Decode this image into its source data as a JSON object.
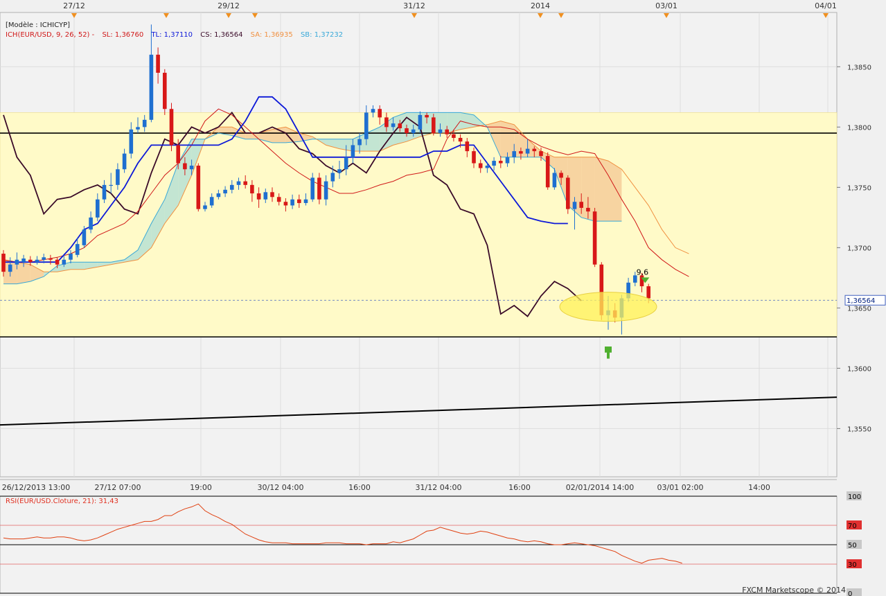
{
  "legend": {
    "model": "[Modèle : ICHICYP]",
    "ich": "ICH(EUR/USD, 9, 26, 52) -",
    "sl": "SL: 1,36760",
    "tl": "TL: 1,37110",
    "cs": "CS: 1,36564",
    "sa": "SA: 1,36935",
    "sb": "SB: 1,37232"
  },
  "rsi_label": "RSI(EUR/USD.Cloture, 21): 31,43",
  "copyright": "FXCM Marketscope © 2014",
  "colors": {
    "background": "#f0f0f0",
    "zone": "#fffac8",
    "bull": "#1f6fd0",
    "bear": "#d81818",
    "tenkan": "#d01818",
    "kijun": "#0c18d8",
    "chikou": "#3a0a28",
    "senkou_a": "#f09040",
    "senkou_b": "#38a8d8",
    "rsi": "#e04010",
    "level_line": "#000000"
  },
  "chart_data": [
    {
      "type": "candlestick",
      "instrument": "EUR/USD",
      "period_labels_top": [
        "27/12",
        "29/12",
        "31/12",
        "2014",
        "03/01",
        "04/01"
      ],
      "time_labels_bottom": [
        "26/12/2013 13:00",
        "27/12 07:00",
        "19:00",
        "30/12 04:00",
        "16:00",
        "31/12 04:00",
        "16:00",
        "02/01/2014 14:00",
        "03/01 02:00",
        "14:00"
      ],
      "y_ticks": [
        "1,3850",
        "1,3800",
        "1,3750",
        "1,3700",
        "1,3650",
        "1,3600",
        "1,3550"
      ],
      "ylim": [
        1.351,
        1.3895
      ],
      "current_price": "1,36564",
      "annotation": "9,6",
      "candles": [
        [
          1.3695,
          1.368,
          1.3698,
          1.3676
        ],
        [
          1.368,
          1.3686,
          1.3692,
          1.3676
        ],
        [
          1.3686,
          1.369,
          1.3696,
          1.3682
        ],
        [
          1.3688,
          1.3691,
          1.3694,
          1.3684
        ],
        [
          1.369,
          1.3688,
          1.3693,
          1.3685
        ],
        [
          1.3688,
          1.369,
          1.3693,
          1.3686
        ],
        [
          1.369,
          1.3692,
          1.3695,
          1.3687
        ],
        [
          1.3691,
          1.369,
          1.3694,
          1.3686
        ],
        [
          1.369,
          1.3686,
          1.3692,
          1.3683
        ],
        [
          1.3686,
          1.369,
          1.3694,
          1.3684
        ],
        [
          1.369,
          1.3695,
          1.3698,
          1.3687
        ],
        [
          1.3694,
          1.3703,
          1.3708,
          1.3692
        ],
        [
          1.3702,
          1.3715,
          1.3718,
          1.37
        ],
        [
          1.3715,
          1.3725,
          1.373,
          1.3712
        ],
        [
          1.3725,
          1.374,
          1.3745,
          1.3722
        ],
        [
          1.374,
          1.3752,
          1.3756,
          1.3737
        ],
        [
          1.3752,
          1.3752,
          1.3762,
          1.3745
        ],
        [
          1.3752,
          1.3765,
          1.377,
          1.3748
        ],
        [
          1.3765,
          1.3778,
          1.3782,
          1.3762
        ],
        [
          1.3778,
          1.3798,
          1.3804,
          1.3774
        ],
        [
          1.3798,
          1.38,
          1.3808,
          1.3795
        ],
        [
          1.38,
          1.3806,
          1.381,
          1.3796
        ],
        [
          1.3806,
          1.386,
          1.3885,
          1.3804
        ],
        [
          1.386,
          1.3845,
          1.3866,
          1.3836
        ],
        [
          1.3845,
          1.3815,
          1.3848,
          1.381
        ],
        [
          1.3815,
          1.3785,
          1.382,
          1.378
        ],
        [
          1.3785,
          1.377,
          1.379,
          1.3765
        ],
        [
          1.377,
          1.3765,
          1.3775,
          1.376
        ],
        [
          1.3765,
          1.3768,
          1.3773,
          1.376
        ],
        [
          1.3768,
          1.3732,
          1.377,
          1.373
        ],
        [
          1.3732,
          1.3735,
          1.3738,
          1.373
        ],
        [
          1.3735,
          1.3742,
          1.3745,
          1.3733
        ],
        [
          1.3742,
          1.3745,
          1.3748,
          1.374
        ],
        [
          1.3745,
          1.3748,
          1.3751,
          1.3742
        ],
        [
          1.3748,
          1.3752,
          1.3756,
          1.3745
        ],
        [
          1.3752,
          1.3755,
          1.3758,
          1.3748
        ],
        [
          1.3755,
          1.3752,
          1.376,
          1.3749
        ],
        [
          1.3752,
          1.3745,
          1.3756,
          1.3738
        ],
        [
          1.3745,
          1.374,
          1.375,
          1.3733
        ],
        [
          1.374,
          1.3746,
          1.3749,
          1.3737
        ],
        [
          1.3746,
          1.3742,
          1.375,
          1.3738
        ],
        [
          1.3742,
          1.3738,
          1.3745,
          1.3735
        ],
        [
          1.3738,
          1.3735,
          1.3741,
          1.373
        ],
        [
          1.3735,
          1.374,
          1.3744,
          1.3732
        ],
        [
          1.374,
          1.3737,
          1.3744,
          1.3733
        ],
        [
          1.3737,
          1.374,
          1.3745,
          1.3735
        ],
        [
          1.374,
          1.3758,
          1.3762,
          1.3738
        ],
        [
          1.3758,
          1.374,
          1.3762,
          1.3736
        ],
        [
          1.374,
          1.3755,
          1.376,
          1.3735
        ],
        [
          1.3755,
          1.3762,
          1.3768,
          1.375
        ],
        [
          1.3762,
          1.3765,
          1.3772,
          1.3757
        ],
        [
          1.3765,
          1.3775,
          1.3785,
          1.376
        ],
        [
          1.3775,
          1.3785,
          1.379,
          1.377
        ],
        [
          1.3785,
          1.379,
          1.3795,
          1.3778
        ],
        [
          1.379,
          1.3812,
          1.3818,
          1.3785
        ],
        [
          1.3812,
          1.3815,
          1.3818,
          1.3808
        ],
        [
          1.3815,
          1.3808,
          1.3818,
          1.3802
        ],
        [
          1.3808,
          1.38,
          1.3812,
          1.3796
        ],
        [
          1.38,
          1.3803,
          1.3808,
          1.3797
        ],
        [
          1.3803,
          1.3799,
          1.3806,
          1.3796
        ],
        [
          1.3799,
          1.3795,
          1.3802,
          1.3792
        ],
        [
          1.3795,
          1.3798,
          1.3802,
          1.3792
        ],
        [
          1.3798,
          1.381,
          1.3813,
          1.3795
        ],
        [
          1.381,
          1.3808,
          1.3812,
          1.3803
        ],
        [
          1.3808,
          1.3795,
          1.3811,
          1.3793
        ],
        [
          1.3795,
          1.3798,
          1.3803,
          1.3792
        ],
        [
          1.3798,
          1.3794,
          1.3801,
          1.3791
        ],
        [
          1.3794,
          1.3791,
          1.3798,
          1.3788
        ],
        [
          1.3791,
          1.3788,
          1.3794,
          1.3783
        ],
        [
          1.3788,
          1.378,
          1.3791,
          1.3775
        ],
        [
          1.378,
          1.377,
          1.3783,
          1.3766
        ],
        [
          1.377,
          1.3766,
          1.3773,
          1.3762
        ],
        [
          1.3766,
          1.3768,
          1.3771,
          1.3762
        ],
        [
          1.3768,
          1.3772,
          1.3775,
          1.3764
        ],
        [
          1.3772,
          1.377,
          1.3776,
          1.3766
        ],
        [
          1.377,
          1.3775,
          1.3779,
          1.3767
        ],
        [
          1.3775,
          1.378,
          1.3786,
          1.377
        ],
        [
          1.378,
          1.3778,
          1.3783,
          1.3773
        ],
        [
          1.3778,
          1.3782,
          1.379,
          1.3775
        ],
        [
          1.3782,
          1.378,
          1.3784,
          1.3775
        ],
        [
          1.378,
          1.3776,
          1.3783,
          1.3772
        ],
        [
          1.3776,
          1.375,
          1.3779,
          1.3748
        ],
        [
          1.375,
          1.3762,
          1.3766,
          1.3748
        ],
        [
          1.3762,
          1.3758,
          1.3764,
          1.3752
        ],
        [
          1.3758,
          1.3732,
          1.376,
          1.3728
        ],
        [
          1.3732,
          1.3738,
          1.3742,
          1.3715
        ],
        [
          1.3738,
          1.3733,
          1.3745,
          1.3728
        ],
        [
          1.3733,
          1.373,
          1.3742,
          1.3724
        ],
        [
          1.373,
          1.3686,
          1.3733,
          1.3684
        ],
        [
          1.3686,
          1.3644,
          1.3688,
          1.364
        ],
        [
          1.3644,
          1.3648,
          1.366,
          1.3632
        ],
        [
          1.3648,
          1.3642,
          1.3654,
          1.3638
        ],
        [
          1.3642,
          1.3658,
          1.3661,
          1.3628
        ],
        [
          1.3658,
          1.3671,
          1.3675,
          1.3655
        ],
        [
          1.3671,
          1.3677,
          1.368,
          1.3668
        ],
        [
          1.3677,
          1.3668,
          1.3679,
          1.3663
        ],
        [
          1.3668,
          1.3658,
          1.367,
          1.3654
        ]
      ],
      "tenkan": [
        1.369,
        1.3688,
        1.3688,
        1.369,
        1.3692,
        1.3695,
        1.37,
        1.371,
        1.3715,
        1.372,
        1.373,
        1.3745,
        1.376,
        1.377,
        1.3785,
        1.3805,
        1.3815,
        1.381,
        1.38,
        1.379,
        1.378,
        1.377,
        1.3762,
        1.3755,
        1.375,
        1.3745,
        1.3745,
        1.3748,
        1.3752,
        1.3755,
        1.376,
        1.3762,
        1.3765,
        1.379,
        1.3805,
        1.3802,
        1.38,
        1.38,
        1.3798,
        1.379,
        1.3784,
        1.378,
        1.3777,
        1.378,
        1.3778,
        1.376,
        1.374,
        1.3722,
        1.37,
        1.369,
        1.3682,
        1.3676
      ],
      "kijun": [
        1.3688,
        1.3688,
        1.3688,
        1.3688,
        1.3688,
        1.37,
        1.3715,
        1.372,
        1.3735,
        1.375,
        1.377,
        1.3785,
        1.3785,
        1.3785,
        1.3785,
        1.3785,
        1.3785,
        1.379,
        1.3805,
        1.3825,
        1.3825,
        1.3815,
        1.3795,
        1.3775,
        1.3775,
        1.3775,
        1.3775,
        1.3775,
        1.3775,
        1.3775,
        1.3775,
        1.3775,
        1.378,
        1.378,
        1.3785,
        1.3785,
        1.377,
        1.3755,
        1.374,
        1.3725,
        1.3722,
        1.372,
        1.372
      ],
      "chikou": [
        1.381,
        1.3775,
        1.376,
        1.3728,
        1.374,
        1.3742,
        1.3748,
        1.3752,
        1.3745,
        1.3732,
        1.3728,
        1.3762,
        1.379,
        1.3785,
        1.38,
        1.3795,
        1.38,
        1.3812,
        1.3795,
        1.3795,
        1.38,
        1.3795,
        1.3782,
        1.3778,
        1.3768,
        1.3762,
        1.377,
        1.3762,
        1.378,
        1.3795,
        1.3808,
        1.38,
        1.376,
        1.3752,
        1.3732,
        1.3728,
        1.3702,
        1.3645,
        1.3652,
        1.3643,
        1.366,
        1.3672,
        1.3666,
        1.3656
      ],
      "senkou_a": [
        1.3689,
        1.3688,
        1.3686,
        1.368,
        1.368,
        1.3682,
        1.3682,
        1.3684,
        1.3686,
        1.3688,
        1.369,
        1.37,
        1.372,
        1.3735,
        1.376,
        1.379,
        1.38,
        1.38,
        1.3795,
        1.3795,
        1.3798,
        1.38,
        1.3795,
        1.3792,
        1.3785,
        1.3782,
        1.378,
        1.378,
        1.378,
        1.3785,
        1.3788,
        1.3792,
        1.3795,
        1.3795,
        1.3798,
        1.38,
        1.3802,
        1.3805,
        1.3802,
        1.379,
        1.378,
        1.3775,
        1.3775,
        1.3775,
        1.3775,
        1.3772,
        1.3765,
        1.375,
        1.3735,
        1.3715,
        1.37,
        1.3695
      ],
      "senkou_b": [
        1.367,
        1.367,
        1.3672,
        1.3676,
        1.3685,
        1.3688,
        1.3688,
        1.3688,
        1.3688,
        1.369,
        1.3698,
        1.372,
        1.374,
        1.377,
        1.379,
        1.379,
        1.3795,
        1.3793,
        1.379,
        1.379,
        1.3787,
        1.3787,
        1.3788,
        1.379,
        1.379,
        1.379,
        1.379,
        1.3795,
        1.38,
        1.3808,
        1.3812,
        1.3812,
        1.3812,
        1.3812,
        1.3812,
        1.381,
        1.38,
        1.3775,
        1.3775,
        1.3775,
        1.3775,
        1.3765,
        1.3735,
        1.3725,
        1.3722,
        1.3722,
        1.3722
      ],
      "horizontal_levels": [
        1.3812,
        1.3795,
        1.3626
      ],
      "trend_line": {
        "start": 1.3553,
        "end": 1.3576
      }
    },
    {
      "type": "line",
      "name": "RSI(EUR/USD.Cloture, 21)",
      "ylim": [
        0,
        100
      ],
      "levels": [
        100,
        70,
        50,
        30,
        0
      ],
      "values": [
        57,
        56,
        56,
        56,
        57,
        58,
        57,
        57,
        58,
        58,
        57,
        55,
        54,
        55,
        57,
        60,
        63,
        66,
        68,
        70,
        72,
        74,
        74,
        76,
        80,
        80,
        84,
        87,
        89,
        92,
        85,
        81,
        78,
        74,
        71,
        66,
        61,
        58,
        55,
        53,
        52,
        52,
        52,
        51,
        51,
        51,
        51,
        51,
        52,
        52,
        52,
        51,
        51,
        51,
        50,
        51,
        51,
        51,
        53,
        52,
        54,
        56,
        60,
        64,
        65,
        68,
        66,
        64,
        62,
        61,
        62,
        64,
        63,
        61,
        59,
        57,
        56,
        54,
        53,
        54,
        53,
        51,
        50,
        50,
        51,
        52,
        51,
        50,
        49,
        47,
        45,
        43,
        39,
        36,
        33,
        31,
        34,
        35,
        36,
        34,
        33,
        31
      ]
    }
  ]
}
